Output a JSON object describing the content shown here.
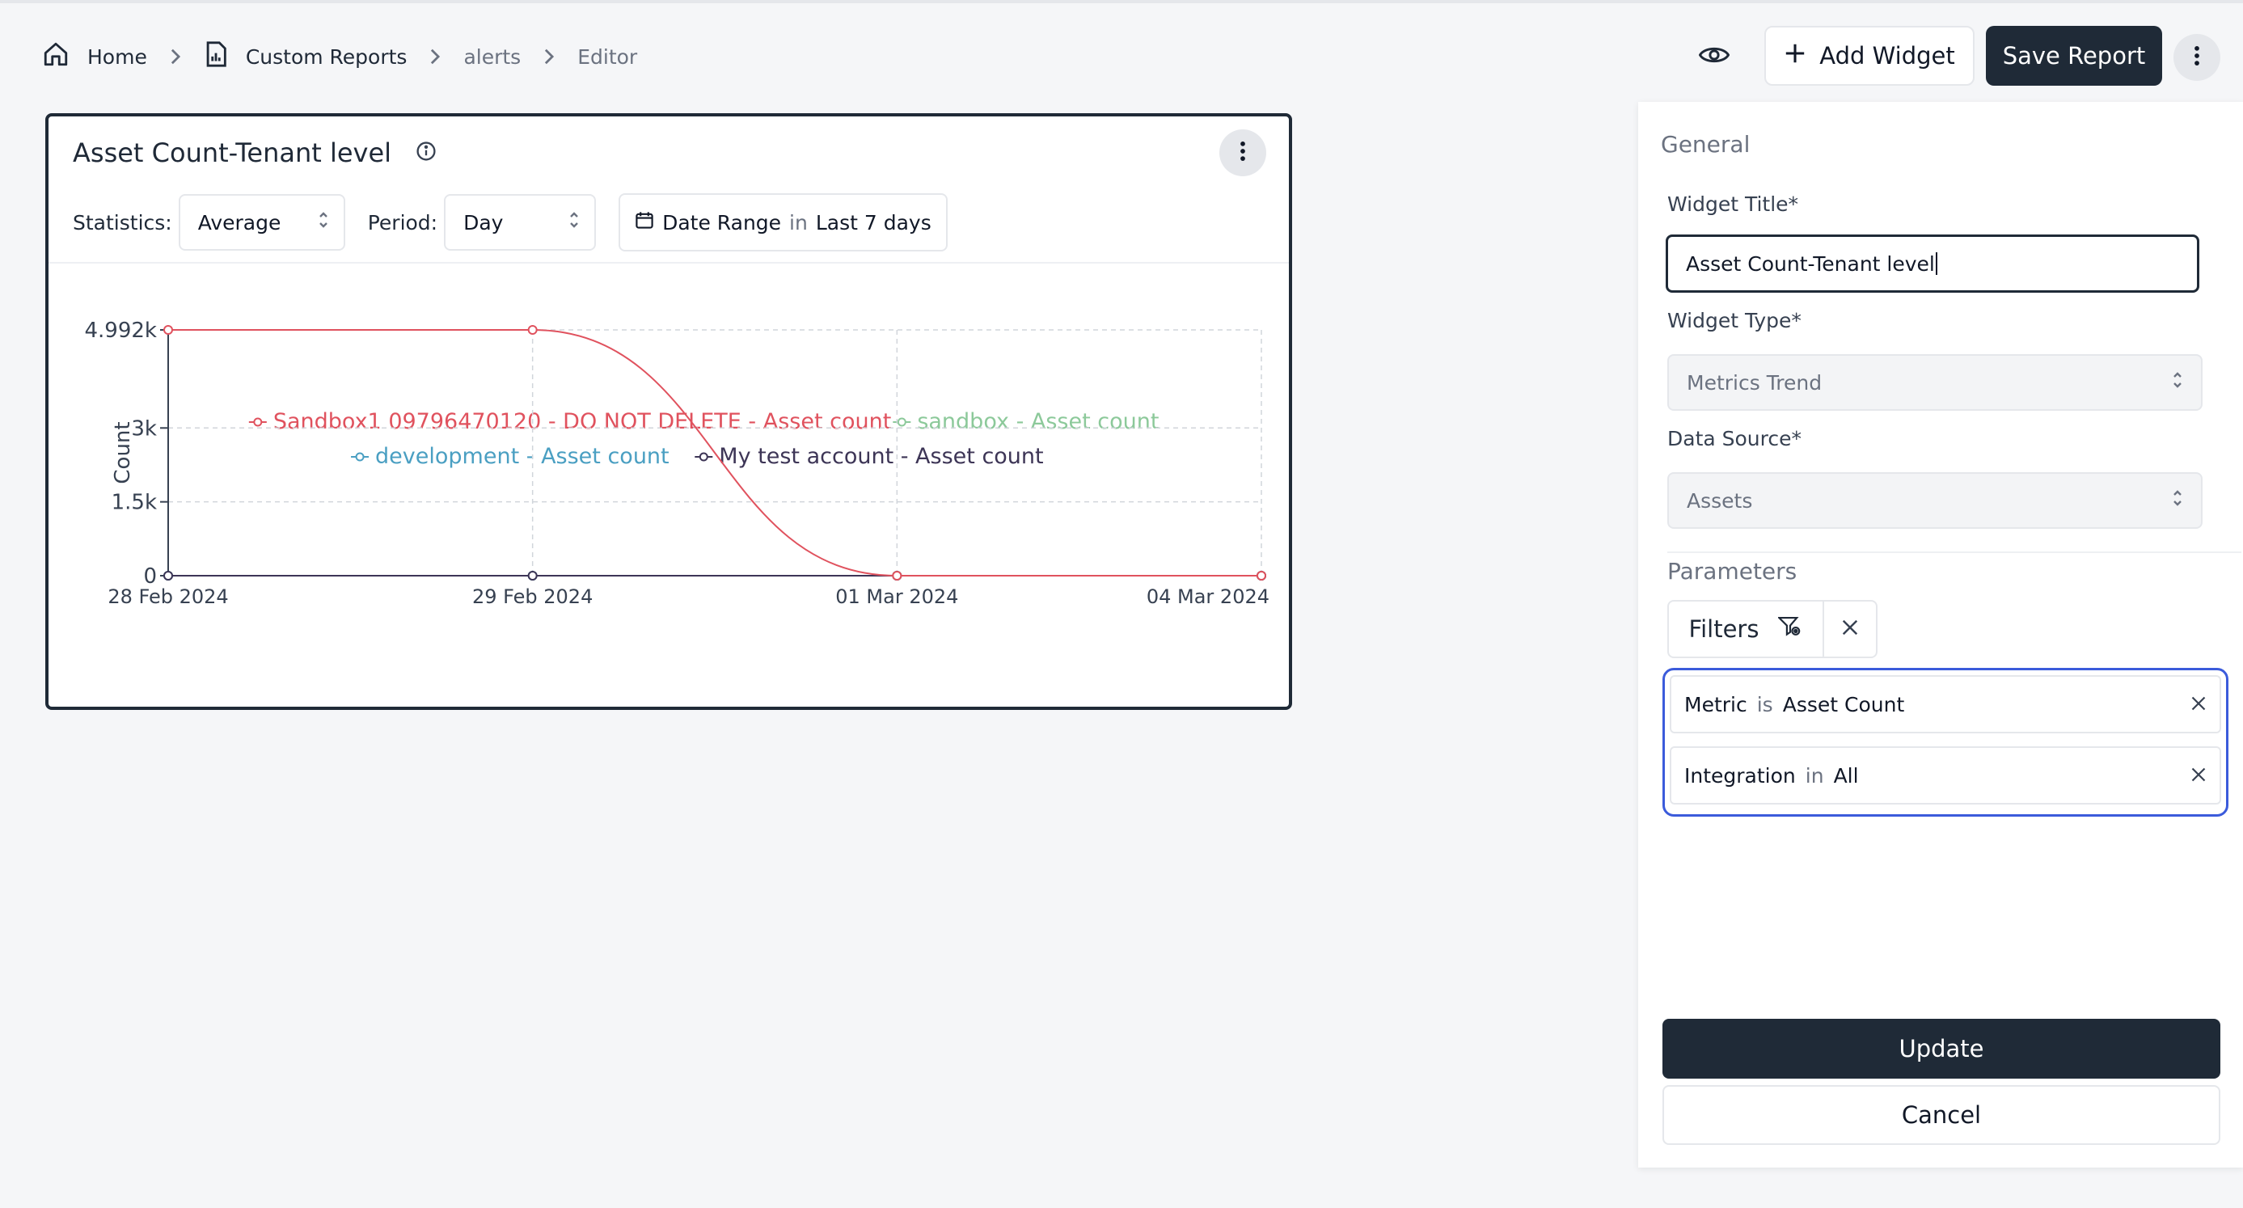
{
  "breadcrumb": {
    "items": [
      "Home",
      "Custom Reports",
      "alerts",
      "Editor"
    ]
  },
  "header": {
    "add_widget_label": "Add Widget",
    "save_report_label": "Save Report"
  },
  "widget": {
    "title": "Asset Count-Tenant level",
    "statistics_label": "Statistics:",
    "statistics_value": "Average",
    "period_label": "Period:",
    "period_value": "Day",
    "date_range_label": "Date Range",
    "date_range_op": "in",
    "date_range_value": "Last 7 days"
  },
  "chart_data": {
    "type": "line",
    "x": [
      "28 Feb 2024",
      "29 Feb 2024",
      "01 Mar 2024",
      "04 Mar 2024"
    ],
    "ylabel": "Count",
    "yticks": [
      "0",
      "1.5k",
      "3k",
      "4.992k"
    ],
    "ylim": [
      0,
      4992
    ],
    "grid": true,
    "legend_position": "top",
    "series": [
      {
        "name": "Sandbox1 09796470120 - DO NOT DELETE - Asset count",
        "color": "#e0525e",
        "values": [
          4992,
          4992,
          0,
          0
        ]
      },
      {
        "name": "sandbox - Asset count",
        "color": "#8cc99a",
        "values": [
          0,
          0,
          0,
          0
        ]
      },
      {
        "name": "development - Asset count",
        "color": "#4a9fc2",
        "values": [
          0,
          0,
          0,
          0
        ]
      },
      {
        "name": "My test account - Asset count",
        "color": "#3d3556",
        "values": [
          0,
          0,
          0,
          0
        ]
      }
    ]
  },
  "panel": {
    "general_heading": "General",
    "widget_title_label": "Widget Title*",
    "widget_title_value": "Asset Count-Tenant level",
    "widget_type_label": "Widget Type*",
    "widget_type_value": "Metrics Trend",
    "data_source_label": "Data Source*",
    "data_source_value": "Assets",
    "parameters_heading": "Parameters",
    "filters_label": "Filters",
    "filters": [
      {
        "field": "Metric",
        "op": "is",
        "value": "Asset Count"
      },
      {
        "field": "Integration",
        "op": "in",
        "value": "All"
      }
    ],
    "update_label": "Update",
    "cancel_label": "Cancel"
  }
}
